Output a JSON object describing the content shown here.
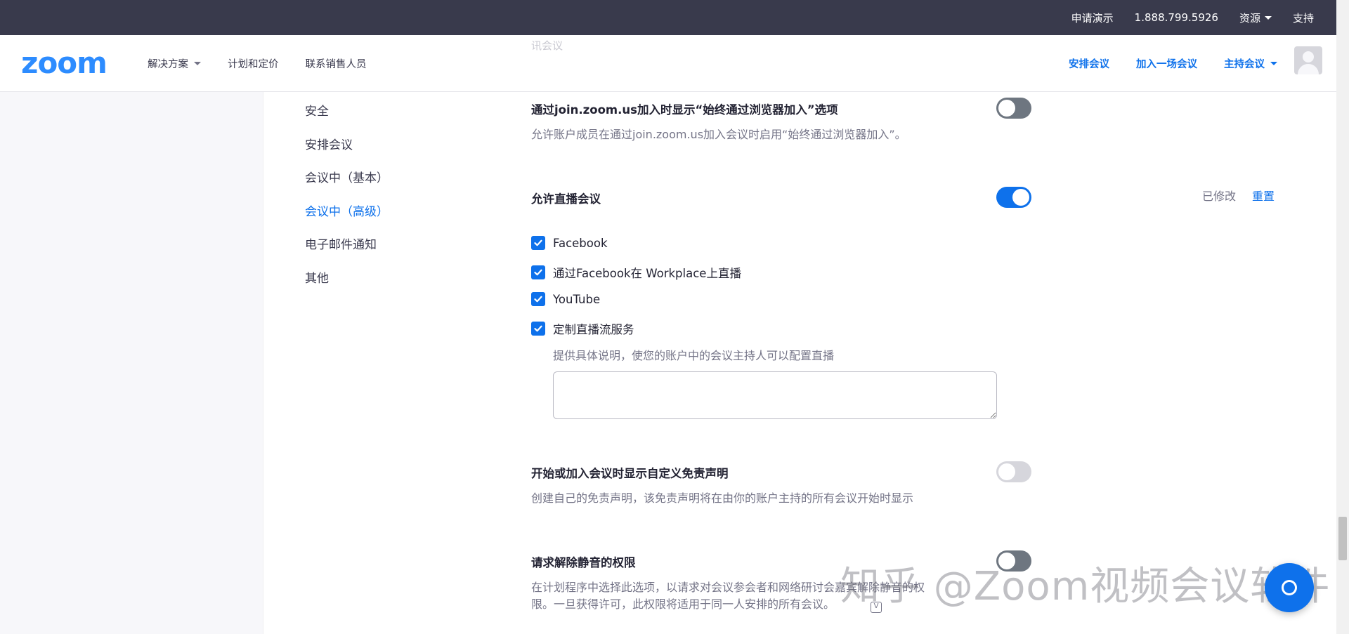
{
  "topbar": {
    "items": [
      {
        "label": "申请演示"
      },
      {
        "label": "1.888.799.5926"
      },
      {
        "label": "资源"
      },
      {
        "label": "支持"
      }
    ]
  },
  "header": {
    "logo": "zoom",
    "nav": [
      {
        "label": "解决方案"
      },
      {
        "label": "计划和定价"
      },
      {
        "label": "联系销售人员"
      }
    ],
    "right_nav": [
      {
        "label": "安排会议"
      },
      {
        "label": "加入一场会议"
      },
      {
        "label": "主持会议"
      }
    ]
  },
  "sidebar": {
    "items": [
      {
        "label": "安全",
        "active": false
      },
      {
        "label": "安排会议",
        "active": false
      },
      {
        "label": "会议中（基本）",
        "active": false
      },
      {
        "label": "会议中（高级）",
        "active": true
      },
      {
        "label": "电子邮件通知",
        "active": false
      },
      {
        "label": "其他",
        "active": false
      }
    ]
  },
  "settings": {
    "faded_heading": "讯会议",
    "browser_join": {
      "title": "通过join.zoom.us加入时显示“始终通过浏览器加入”选项",
      "desc": "允许账户成员在通过join.zoom.us加入会议时启用“始终通过浏览器加入”。",
      "toggle_on": false
    },
    "live_stream": {
      "title": "允许直播会议",
      "toggle_on": true,
      "modified": "已修改",
      "reset": "重置",
      "options": [
        {
          "label": "Facebook",
          "checked": true
        },
        {
          "label": "通过Facebook在 Workplace上直播",
          "checked": true
        },
        {
          "label": "YouTube",
          "checked": true
        },
        {
          "label": "定制直播流服务",
          "checked": true
        }
      ],
      "custom_hint": "提供具体说明，使您的账户中的会议主持人可以配置直播",
      "custom_value": ""
    },
    "disclaimer": {
      "title": "开始或加入会议时显示自定义免责声明",
      "desc": "创建自己的免责声明，该免责声明将在由你的账户主持的所有会议开始时显示",
      "toggle_on": false
    },
    "unmute": {
      "title": "请求解除静音的权限",
      "desc_line1": "在计划程序中选择此选项，以请求对会议参会者和网络研讨会嘉宾解除静音的权",
      "desc_line2": "限。一旦获得许可，此权限将适用于同一人安排的所有会议。",
      "toggle_on": false
    }
  },
  "watermark": "知乎 @Zoom视频会议软件",
  "colors": {
    "brand": "#2d8cff",
    "accent": "#0e71eb",
    "topbar": "#393a4c"
  }
}
